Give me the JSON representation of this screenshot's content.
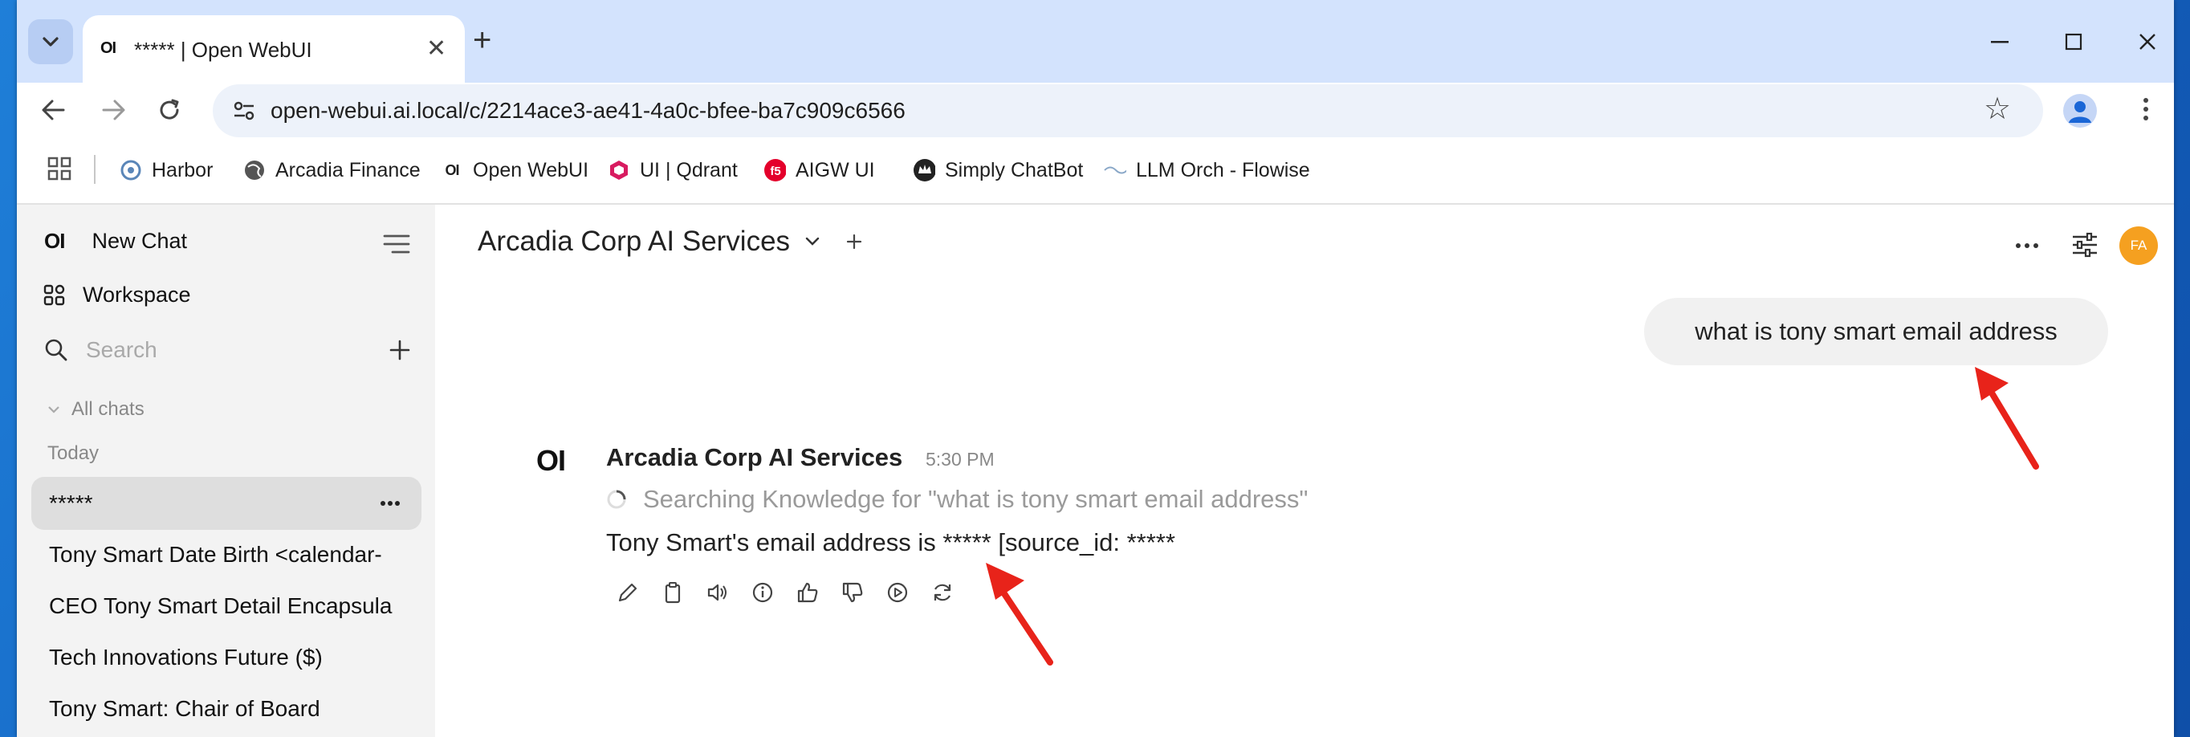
{
  "browser": {
    "tab": {
      "title": "***** | Open WebUI",
      "favicon": "OI"
    },
    "url": "open-webui.ai.local/c/2214ace3-ae41-4a0c-bfee-ba7c909c6566",
    "bookmarks": [
      {
        "label": "Harbor",
        "icon": "harbor-icon"
      },
      {
        "label": "Arcadia Finance",
        "icon": "globe-icon"
      },
      {
        "label": "Open WebUI",
        "icon": "OI"
      },
      {
        "label": "UI | Qdrant",
        "icon": "qdrant-icon"
      },
      {
        "label": "AIGW UI",
        "icon": "f5-icon"
      },
      {
        "label": "Simply ChatBot",
        "icon": "crown-icon"
      },
      {
        "label": "LLM Orch - Flowise",
        "icon": "wave-icon"
      }
    ]
  },
  "sidebar": {
    "logo": "OI",
    "new_chat": "New Chat",
    "workspace": "Workspace",
    "search_placeholder": "Search",
    "all_chats": "All chats",
    "today": "Today",
    "chats": [
      "*****",
      "Tony Smart Date Birth <calendar-",
      "CEO Tony Smart Detail Encapsula",
      "Tech Innovations Future ($)",
      "Tony Smart: Chair of Board"
    ]
  },
  "header": {
    "model": "Arcadia Corp AI Services",
    "avatar_initials": "FA",
    "avatar_color": "#f5a020"
  },
  "conversation": {
    "user_message": "what is tony smart email address",
    "assistant": {
      "logo": "OI",
      "name": "Arcadia Corp AI Services",
      "time": "5:30 PM",
      "status": "Searching Knowledge for \"what is tony smart email address\"",
      "answer": "Tony Smart's email address is ***** [source_id: *****"
    }
  },
  "annotation_color": "#e8231a"
}
